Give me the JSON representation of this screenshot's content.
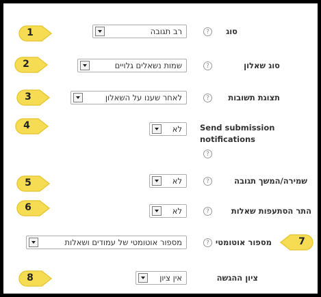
{
  "rows": [
    {
      "label": "סוג",
      "value": "רב תגובה"
    },
    {
      "label": "סוג שאלון",
      "value": "שמות נשאלים גלויים"
    },
    {
      "label": "תצוגת תשובות",
      "value": "לאחר שענו על השאלון"
    },
    {
      "label_line1": "Send submission",
      "label_line2": "notifications",
      "value": "לא"
    },
    {
      "label": "שמירה/המשך תגובה",
      "value": "לא"
    },
    {
      "label": "התר הסתעפות שאלות",
      "value": "לא"
    },
    {
      "label": "מספור אוטומטי",
      "value": "מספור אוטומטי של עמודים ושאלות"
    },
    {
      "label": "ציון ההגשה",
      "value": "אין ציון"
    }
  ],
  "badges": [
    "1",
    "2",
    "3",
    "4",
    "5",
    "6",
    "7",
    "8"
  ],
  "help_glyph": "?",
  "colors": {
    "badge_fill": "#f5dc52",
    "badge_stroke": "#e8c93a",
    "frame": "#000000"
  }
}
